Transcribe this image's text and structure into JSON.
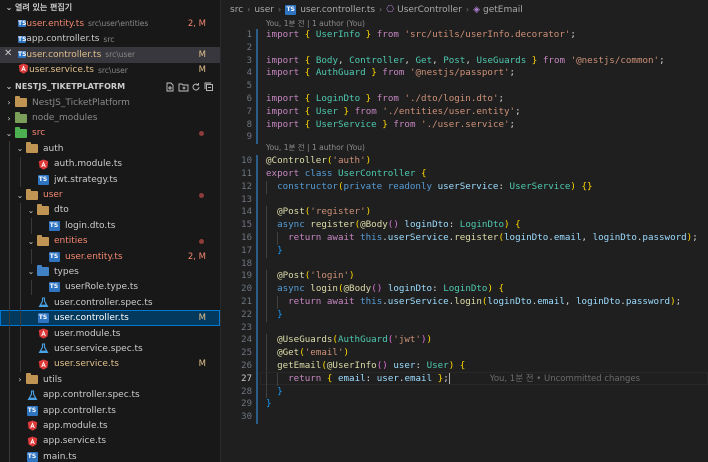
{
  "open_editors": {
    "title": "열려 있는 편집기",
    "items": [
      {
        "name": "user.entity.ts",
        "desc": "src\\user\\entities",
        "badge": "2, M",
        "icon": "ts-icon",
        "tone": "red"
      },
      {
        "name": "app.controller.ts",
        "desc": "src",
        "badge": "",
        "icon": "ts-icon",
        "tone": "normal"
      },
      {
        "name": "user.controller.ts",
        "desc": "src\\user",
        "badge": "M",
        "icon": "ts-icon",
        "tone": "mod",
        "selected": true,
        "close": "✕"
      },
      {
        "name": "user.service.ts",
        "desc": "src\\user",
        "badge": "M",
        "icon": "angular-icon",
        "tone": "mod"
      }
    ]
  },
  "explorer": {
    "title": "NESTJS_TIKETPLATFORM",
    "rows": [
      {
        "label": "NestJS_TicketPlatform",
        "depth": 1,
        "chev": "›",
        "icon": "folder-icon",
        "color": "#8a8a8a"
      },
      {
        "label": "node_modules",
        "depth": 1,
        "chev": "›",
        "icon": "node-folder-icon",
        "color": "#8a8a8a"
      },
      {
        "label": "src",
        "depth": 1,
        "chev": "⌄",
        "icon": "src-folder-icon",
        "tone": "red",
        "dot": true
      },
      {
        "label": "auth",
        "depth": 2,
        "chev": "⌄",
        "icon": "folder-open-icon"
      },
      {
        "label": "auth.module.ts",
        "depth": 3,
        "icon": "angular-icon"
      },
      {
        "label": "jwt.strategy.ts",
        "depth": 3,
        "icon": "ts-icon"
      },
      {
        "label": "user",
        "depth": 2,
        "chev": "⌄",
        "icon": "folder-open-icon",
        "tone": "red",
        "dot": true
      },
      {
        "label": "dto",
        "depth": 3,
        "chev": "⌄",
        "icon": "folder-open-icon"
      },
      {
        "label": "login.dto.ts",
        "depth": 4,
        "icon": "ts-icon"
      },
      {
        "label": "entities",
        "depth": 3,
        "chev": "⌄",
        "icon": "folder-open-icon",
        "tone": "red",
        "dot": true
      },
      {
        "label": "user.entity.ts",
        "depth": 4,
        "icon": "ts-icon",
        "tone": "red",
        "badge": "2, M"
      },
      {
        "label": "types",
        "depth": 3,
        "chev": "⌄",
        "icon": "types-folder-icon"
      },
      {
        "label": "userRole.type.ts",
        "depth": 4,
        "icon": "ts-icon"
      },
      {
        "label": "user.controller.spec.ts",
        "depth": 3,
        "icon": "test-icon"
      },
      {
        "label": "user.controller.ts",
        "depth": 3,
        "icon": "ts-icon",
        "tone": "mod",
        "badge": "M",
        "selected": true
      },
      {
        "label": "user.module.ts",
        "depth": 3,
        "icon": "angular-icon"
      },
      {
        "label": "user.service.spec.ts",
        "depth": 3,
        "icon": "test-icon"
      },
      {
        "label": "user.service.ts",
        "depth": 3,
        "icon": "angular-icon",
        "tone": "mod",
        "badge": "M"
      },
      {
        "label": "utils",
        "depth": 2,
        "chev": "›",
        "icon": "folder-icon"
      },
      {
        "label": "app.controller.spec.ts",
        "depth": 2,
        "icon": "test-icon"
      },
      {
        "label": "app.controller.ts",
        "depth": 2,
        "icon": "ts-icon"
      },
      {
        "label": "app.module.ts",
        "depth": 2,
        "icon": "angular-icon"
      },
      {
        "label": "app.service.ts",
        "depth": 2,
        "icon": "angular-icon"
      },
      {
        "label": "main.ts",
        "depth": 2,
        "icon": "ts-icon"
      }
    ]
  },
  "breadcrumb": {
    "parts": [
      "src",
      "user",
      "user.controller.ts",
      "UserController",
      "getEmail"
    ],
    "sep": "›"
  },
  "editor": {
    "lens_blame_1": "You, 1분 전 | 1 author (You)",
    "lens_blame_2": "You, 1분 전 | 1 author (You)",
    "ghost_text": "You, 1분 전 • Uncommitted changes",
    "current_line": 27,
    "lines": [
      "import { UserInfo } from 'src/utils/userInfo.decorator';",
      "",
      "import { Body, Controller, Get, Post, UseGuards } from '@nestjs/common';",
      "import { AuthGuard } from '@nestjs/passport';",
      "",
      "import { LoginDto } from './dto/login.dto';",
      "import { User } from './entities/user.entity';",
      "import { UserService } from './user.service';",
      "",
      "@Controller('auth')",
      "export class UserController {",
      "  constructor(private readonly userService: UserService) {}",
      "",
      "  @Post('register')",
      "  async register(@Body() loginDto: LoginDto) {",
      "    return await this.userService.register(loginDto.email, loginDto.password);",
      "  }",
      "",
      "  @Post('login')",
      "  async login(@Body() loginDto: LoginDto) {",
      "    return await this.userService.login(loginDto.email, loginDto.password);",
      "  }",
      "",
      "  @UseGuards(AuthGuard('jwt'))",
      "  @Get('email')",
      "  getEmail(@UserInfo() user: User) {",
      "    return { email: user.email };",
      "  }",
      "}",
      ""
    ]
  },
  "colors": {
    "accent": "#0078d4",
    "modified": "#e2c08d",
    "error": "#f48771"
  }
}
